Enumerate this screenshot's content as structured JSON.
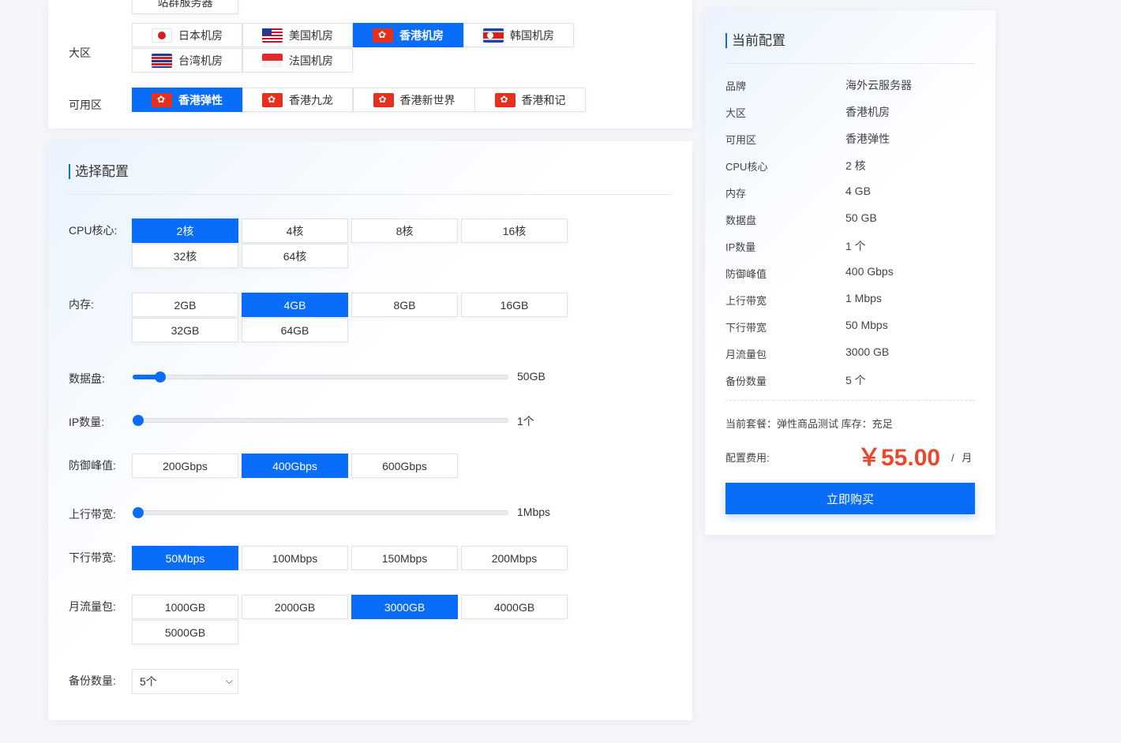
{
  "top_partial_option": "站群服务器",
  "region": {
    "label": "大区",
    "options": [
      {
        "name": "日本机房",
        "flag": "jp"
      },
      {
        "name": "美国机房",
        "flag": "us"
      },
      {
        "name": "香港机房",
        "flag": "hk",
        "active": true
      },
      {
        "name": "韩国机房",
        "flag": "kp"
      },
      {
        "name": "台湾机房",
        "flag": "tw"
      },
      {
        "name": "法国机房",
        "flag": "sg"
      }
    ]
  },
  "zone": {
    "label": "可用区",
    "options": [
      {
        "name": "香港弹性",
        "active": true
      },
      {
        "name": "香港九龙"
      },
      {
        "name": "香港新世界"
      },
      {
        "name": "香港和记"
      }
    ]
  },
  "config": {
    "title": "选择配置",
    "cpu": {
      "label": "CPU核心:",
      "options": [
        "2核",
        "4核",
        "8核",
        "16核",
        "32核",
        "64核"
      ],
      "selected": "2核"
    },
    "memory": {
      "label": "内存:",
      "options": [
        "2GB",
        "4GB",
        "8GB",
        "16GB",
        "32GB",
        "64GB"
      ],
      "selected": "4GB"
    },
    "disk": {
      "label": "数据盘:",
      "value_label": "50GB",
      "level": 0.06
    },
    "ip": {
      "label": "IP数量:",
      "value_label": "1个",
      "level": 0
    },
    "ddos": {
      "label": "防御峰值:",
      "options": [
        "200Gbps",
        "400Gbps",
        "600Gbps"
      ],
      "selected": "400Gbps"
    },
    "upload": {
      "label": "上行带宽:",
      "value_label": "1Mbps",
      "level": 0
    },
    "download": {
      "label": "下行带宽:",
      "options": [
        "50Mbps",
        "100Mbps",
        "150Mbps",
        "200Mbps"
      ],
      "selected": "50Mbps"
    },
    "traffic": {
      "label": "月流量包:",
      "options": [
        "1000GB",
        "2000GB",
        "3000GB",
        "4000GB",
        "5000GB"
      ],
      "selected": "3000GB"
    },
    "backup": {
      "label": "备份数量:",
      "selected": "5个"
    }
  },
  "summary": {
    "title": "当前配置",
    "rows": [
      {
        "k": "品牌",
        "v": "海外云服务器"
      },
      {
        "k": "大区",
        "v": "香港机房"
      },
      {
        "k": "可用区",
        "v": "香港弹性"
      },
      {
        "k": "CPU核心",
        "v": "2 核"
      },
      {
        "k": "内存",
        "v": "4 GB"
      },
      {
        "k": "数据盘",
        "v": "50 GB"
      },
      {
        "k": "IP数量",
        "v": "1 个"
      },
      {
        "k": "防御峰值",
        "v": "400 Gbps"
      },
      {
        "k": "上行带宽",
        "v": "1 Mbps"
      },
      {
        "k": "下行带宽",
        "v": "50 Mbps"
      },
      {
        "k": "月流量包",
        "v": "3000 GB"
      },
      {
        "k": "备份数量",
        "v": "5 个"
      }
    ],
    "package_text": "当前套餐：弹性商品测试 库存：充足",
    "fee_label": "配置费用:",
    "price": "￥55.00",
    "unit": "/ 月",
    "buy_label": "立即购买"
  },
  "colors": {
    "accent": "#0a6dfa",
    "price": "#e8492c"
  }
}
